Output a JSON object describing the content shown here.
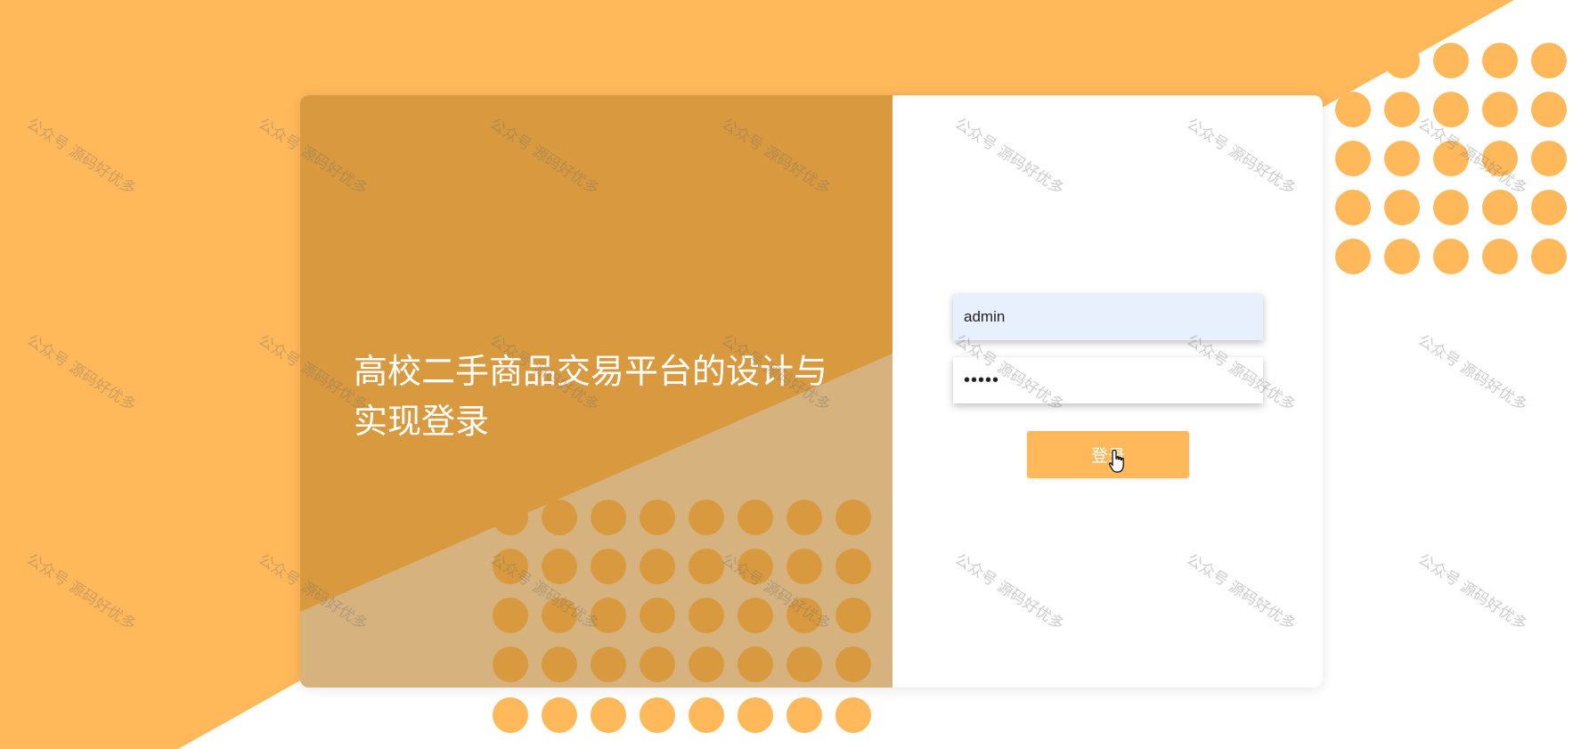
{
  "login": {
    "system_title": "高校二手商品交易平台的设计与实现登录",
    "username_value": "admin",
    "password_value": "•••••",
    "login_button_label": "登录"
  },
  "watermark": {
    "text": "公众号 源码好优多"
  },
  "colors": {
    "page_orange": "#ffb85a",
    "card_left": "#d99a3f",
    "light_triangle": "#d6b27e",
    "dot_orange": "#ffb85a",
    "username_field_bg": "#e8f0fe",
    "button_bg": "#ffb85a"
  },
  "icons": {
    "cursor": "hand-pointer-icon",
    "dot_pattern": "dot-grid-decoration"
  }
}
